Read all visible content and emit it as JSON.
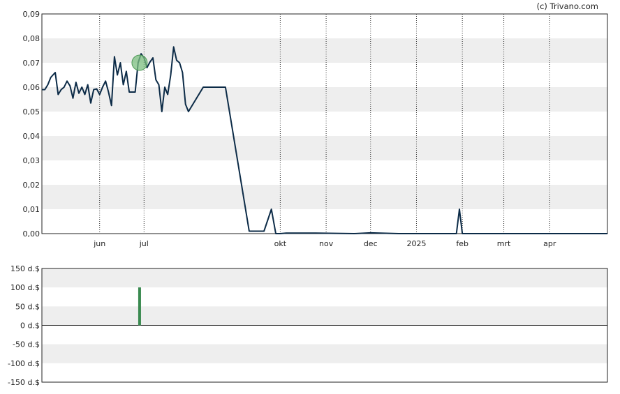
{
  "credit": "(c) Trivano.com",
  "colors": {
    "line": "#0c2b47",
    "band": "#eeeeee",
    "bar": "#3a8a50",
    "marker": "#7cbf80"
  },
  "chart_data": [
    {
      "type": "line",
      "grid": "vertical dotted lines at month ticks; alternating horizontal bands",
      "ylim": [
        0,
        0.09
      ],
      "yticks": [
        0,
        0.01,
        0.02,
        0.03,
        0.04,
        0.05,
        0.06,
        0.07,
        0.08,
        0.09
      ],
      "ytick_labels": [
        "0,00",
        "0,01",
        "0,02",
        "0,03",
        "0,04",
        "0,05",
        "0,06",
        "0,07",
        "0,08",
        "0,09"
      ],
      "xlim": [
        "2024-04-23",
        "2025-05-10"
      ],
      "xticks": [
        {
          "label": "jun",
          "date": "2024-06-01"
        },
        {
          "label": "jul",
          "date": "2024-07-01"
        },
        {
          "label": "okt",
          "date": "2024-10-01"
        },
        {
          "label": "nov",
          "date": "2024-11-01"
        },
        {
          "label": "dec",
          "date": "2024-12-01"
        },
        {
          "label": "2025",
          "date": "2025-01-01"
        },
        {
          "label": "feb",
          "date": "2025-02-01"
        },
        {
          "label": "mrt",
          "date": "2025-03-01"
        },
        {
          "label": "apr",
          "date": "2025-04-01"
        }
      ],
      "x": [
        "2024-04-23",
        "2024-04-25",
        "2024-04-27",
        "2024-04-29",
        "2024-05-02",
        "2024-05-04",
        "2024-05-06",
        "2024-05-08",
        "2024-05-10",
        "2024-05-12",
        "2024-05-14",
        "2024-05-16",
        "2024-05-18",
        "2024-05-20",
        "2024-05-22",
        "2024-05-24",
        "2024-05-26",
        "2024-05-28",
        "2024-05-30",
        "2024-06-01",
        "2024-06-03",
        "2024-06-05",
        "2024-06-07",
        "2024-06-09",
        "2024-06-11",
        "2024-06-13",
        "2024-06-15",
        "2024-06-17",
        "2024-06-19",
        "2024-06-21",
        "2024-06-23",
        "2024-06-25",
        "2024-06-27",
        "2024-06-29",
        "2024-07-01",
        "2024-07-03",
        "2024-07-05",
        "2024-07-07",
        "2024-07-09",
        "2024-07-11",
        "2024-07-13",
        "2024-07-15",
        "2024-07-17",
        "2024-07-19",
        "2024-07-21",
        "2024-07-23",
        "2024-07-25",
        "2024-07-27",
        "2024-07-29",
        "2024-07-31",
        "2024-08-10",
        "2024-08-25",
        "2024-09-10",
        "2024-09-20",
        "2024-09-25",
        "2024-09-28",
        "2024-10-01",
        "2024-10-05",
        "2024-10-25",
        "2024-11-20",
        "2024-12-01",
        "2024-12-20",
        "2025-01-10",
        "2025-01-20",
        "2025-01-28",
        "2025-01-30",
        "2025-02-01",
        "2025-02-10",
        "2025-03-01",
        "2025-04-01",
        "2025-05-10"
      ],
      "series": [
        {
          "values": [
            0.059,
            0.059,
            0.061,
            0.064,
            0.066,
            0.057,
            0.059,
            0.06,
            0.0625,
            0.0605,
            0.0555,
            0.062,
            0.0575,
            0.06,
            0.057,
            0.061,
            0.0535,
            0.059,
            0.0593,
            0.057,
            0.06,
            0.0625,
            0.058,
            0.0525,
            0.0725,
            0.065,
            0.07,
            0.061,
            0.0665,
            0.058,
            0.058,
            0.058,
            0.07,
            0.0737,
            0.072,
            0.068,
            0.0703,
            0.072,
            0.063,
            0.061,
            0.05,
            0.06,
            0.057,
            0.065,
            0.0765,
            0.071,
            0.07,
            0.066,
            0.053,
            0.05,
            0.06,
            0.06,
            0.001,
            0.001,
            0.01,
            0.0,
            0.0,
            0.0002,
            0.0002,
            0.0,
            0.0003,
            0.0,
            0.0,
            0.0,
            0.0,
            0.01,
            0.0,
            0.0,
            0.0,
            0.0,
            0.0
          ]
        }
      ],
      "markers": [
        {
          "x": "2024-06-28",
          "y": 0.07
        }
      ]
    },
    {
      "type": "bar",
      "ylim": [
        -150,
        150
      ],
      "yticks": [
        150,
        100,
        50,
        0,
        -50,
        -100,
        -150
      ],
      "ytick_labels": [
        "150 d.$",
        "100 d.$",
        "50 d.$",
        "0 d.$",
        "-50 d.$",
        "-100 d.$",
        "-150 d.$"
      ],
      "xlim": [
        "2024-04-23",
        "2025-05-10"
      ],
      "x": [
        "2024-06-28"
      ],
      "values": [
        100
      ]
    }
  ]
}
